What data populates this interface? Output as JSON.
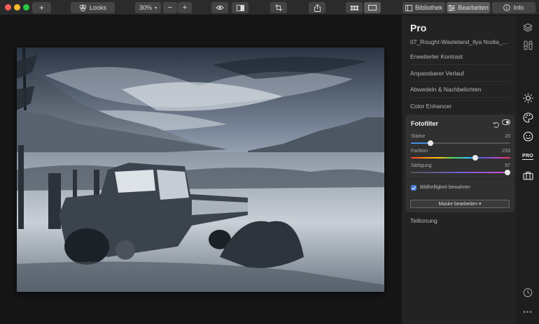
{
  "toolbar": {
    "add_label": "+",
    "looks_label": "Looks",
    "zoom_value": "30%",
    "zoom_minus": "−",
    "zoom_plus": "+",
    "bibliothek_label": "Bibliothek",
    "bearbeiten_label": "Bearbeiten",
    "info_label": "Info"
  },
  "panel": {
    "title": "Pro",
    "file_name": "07_Rought-Wasteland_Ilya Nodia_...",
    "filters": [
      "Erweiterter Kontrast",
      "Anpassbarer Verlauf",
      "Abwedeln & Nachbelichten",
      "Color Enhancer"
    ],
    "active_filter": {
      "title": "Fotofilter",
      "sliders": [
        {
          "label": "Stärke",
          "value": "20",
          "fraction": 0.2
        },
        {
          "label": "Farbton",
          "value": "233",
          "fraction": 0.65
        },
        {
          "label": "Sättigung",
          "value": "97",
          "fraction": 0.97
        }
      ],
      "checkbox_label": "Bildhelligkeit bewahren",
      "checkbox_checked": true,
      "mask_button_label": "Maske bearbeiten ▾"
    },
    "footer_filter": "Teiltonung"
  },
  "rail": {
    "pro_label": "PRO",
    "more_label": "•••"
  },
  "colors": {
    "accent": "#4a90e2",
    "panel_bg": "#232323",
    "card_bg": "#303030"
  },
  "icons": [
    "layers-icon",
    "adjust-icon",
    "sun-icon",
    "palette-icon",
    "face-icon",
    "pro-icon",
    "briefcase-icon",
    "history-icon",
    "more-icon"
  ]
}
